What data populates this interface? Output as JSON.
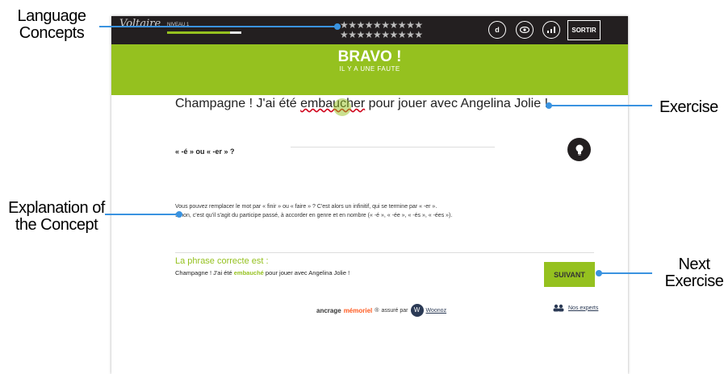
{
  "callouts": {
    "language_concepts": "Language\nConcepts",
    "explanation": "Explanation of\nthe Concept",
    "exercise": "Exercise",
    "next_exercise": "Next\nExercise"
  },
  "header": {
    "logo": "Voltaire",
    "niveau": "NIVEAU 1",
    "progress_fraction": 0.85,
    "stars_row1": "★★★★★★★★★★",
    "stars_row2": "★★★★★★★★★★",
    "icon_dict": "d",
    "sortir": "SORTIR"
  },
  "banner": {
    "title": "BRAVO !",
    "subtitle": "IL Y A UNE FAUTE"
  },
  "exercise": {
    "before": "Champagne ! J'ai été ",
    "error": "embaucher",
    "after": " pour jouer avec Angelina Jolie !"
  },
  "concept": {
    "question": "« -é » ou « -er » ?"
  },
  "explanation": {
    "line1": "Vous pouvez remplacer le mot par « finir » ou « faire » ? C'est alors un infinitif, qui se termine par « -er ».",
    "line2": "Sinon, c'est qu'il s'agit du participe passé, à accorder en genre et en nombre (« -é », « -ée », « -és », « -ées »)."
  },
  "correction": {
    "label": "La phrase correcte est :",
    "before": "Champagne ! J'ai été ",
    "highlight": "embauché",
    "after": " pour jouer avec Angelina Jolie !"
  },
  "buttons": {
    "next": "SUIVANT"
  },
  "footer": {
    "ancrage": "ancrage",
    "memoriel": "mémoriel",
    "reg": "®",
    "assure": "assuré par",
    "woonoz": "Woonoz",
    "experts": "Nos experts"
  },
  "colors": {
    "accent": "#95c11f",
    "dark": "#231f20",
    "error": "#d0021b",
    "memoriel": "#ff5a1f"
  }
}
